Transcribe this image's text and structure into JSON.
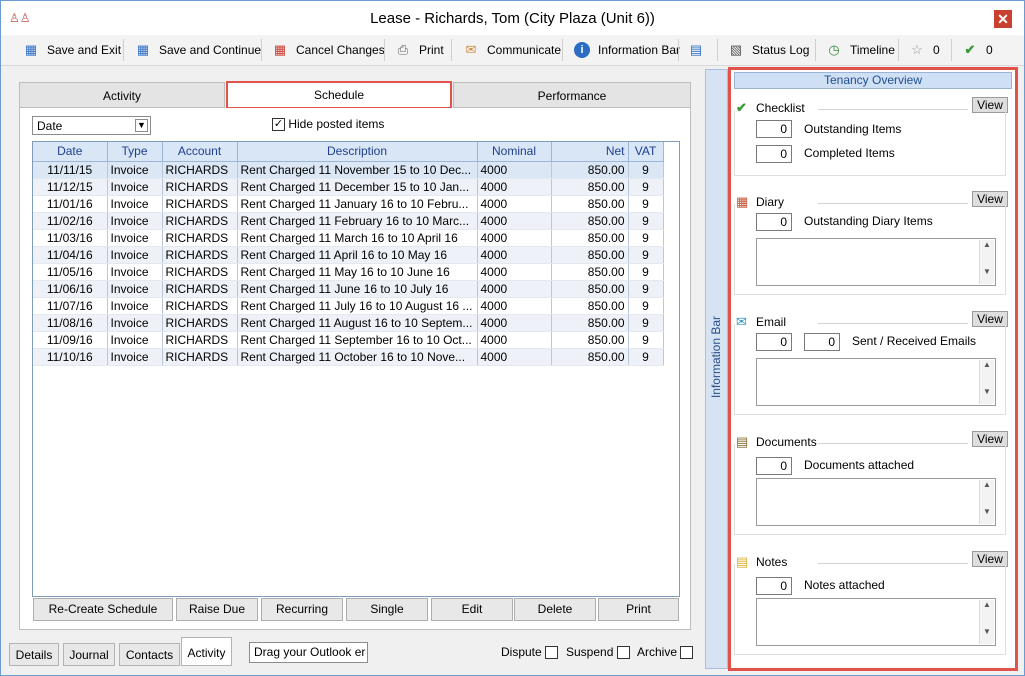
{
  "window": {
    "title": "Lease - Richards, Tom (City Plaza (Unit 6))",
    "close_icon": "close-icon"
  },
  "toolbar": {
    "save_exit": "Save and Exit",
    "save_continue": "Save and Continue",
    "cancel_changes": "Cancel Changes",
    "print": "Print",
    "communicate": "Communicate",
    "information_bar": "Information Bar",
    "status_log": "Status Log",
    "timeline": "Timeline",
    "star_count": "0",
    "check_count": "0"
  },
  "tabs": {
    "activity": "Activity",
    "schedule": "Schedule",
    "performance": "Performance"
  },
  "filter": {
    "sort_value": "Date",
    "hide_posted_label": "Hide posted items",
    "hide_posted_checked": true
  },
  "grid": {
    "columns": [
      "Date",
      "Type",
      "Account",
      "Description",
      "Nominal",
      "Net",
      "VAT"
    ],
    "rows": [
      [
        "11/11/15",
        "Invoice",
        "RICHARDS",
        "Rent Charged 11 November 15 to 10 Dec...",
        "4000",
        "850.00",
        "9"
      ],
      [
        "11/12/15",
        "Invoice",
        "RICHARDS",
        "Rent Charged 11 December 15 to 10 Jan...",
        "4000",
        "850.00",
        "9"
      ],
      [
        "11/01/16",
        "Invoice",
        "RICHARDS",
        "Rent Charged 11 January 16 to 10 Febru...",
        "4000",
        "850.00",
        "9"
      ],
      [
        "11/02/16",
        "Invoice",
        "RICHARDS",
        "Rent Charged 11 February 16 to 10 Marc...",
        "4000",
        "850.00",
        "9"
      ],
      [
        "11/03/16",
        "Invoice",
        "RICHARDS",
        "Rent Charged 11 March 16 to 10 April 16",
        "4000",
        "850.00",
        "9"
      ],
      [
        "11/04/16",
        "Invoice",
        "RICHARDS",
        "Rent Charged 11 April 16 to 10 May 16",
        "4000",
        "850.00",
        "9"
      ],
      [
        "11/05/16",
        "Invoice",
        "RICHARDS",
        "Rent Charged 11 May 16 to 10 June 16",
        "4000",
        "850.00",
        "9"
      ],
      [
        "11/06/16",
        "Invoice",
        "RICHARDS",
        "Rent Charged 11 June 16 to 10 July 16",
        "4000",
        "850.00",
        "9"
      ],
      [
        "11/07/16",
        "Invoice",
        "RICHARDS",
        "Rent Charged 11 July 16 to 10 August 16 ...",
        "4000",
        "850.00",
        "9"
      ],
      [
        "11/08/16",
        "Invoice",
        "RICHARDS",
        "Rent Charged 11 August 16 to 10 Septem...",
        "4000",
        "850.00",
        "9"
      ],
      [
        "11/09/16",
        "Invoice",
        "RICHARDS",
        "Rent Charged 11 September 16 to 10 Oct...",
        "4000",
        "850.00",
        "9"
      ],
      [
        "11/10/16",
        "Invoice",
        "RICHARDS",
        "Rent Charged 11 October 16 to 10 Nove...",
        "4000",
        "850.00",
        "9"
      ]
    ]
  },
  "actions": {
    "recreate": "Re-Create Schedule",
    "raise_due": "Raise Due",
    "recurring": "Recurring",
    "single": "Single",
    "edit": "Edit",
    "delete": "Delete",
    "print": "Print"
  },
  "bottom_tabs": {
    "details": "Details",
    "journal": "Journal",
    "contacts": "Contacts",
    "activity": "Activity"
  },
  "drag_outlook": "Drag your Outlook er",
  "flags": {
    "dispute": "Dispute",
    "suspend": "Suspend",
    "archive": "Archive"
  },
  "infobar": {
    "vertical_label": "Information Bar",
    "header": "Tenancy Overview",
    "view_label": "View",
    "checklist": {
      "title": "Checklist",
      "outstanding": "0",
      "outstanding_label": "Outstanding Items",
      "completed": "0",
      "completed_label": "Completed Items"
    },
    "diary": {
      "title": "Diary",
      "outstanding": "0",
      "outstanding_label": "Outstanding Diary Items"
    },
    "email": {
      "title": "Email",
      "sent": "0",
      "received": "0",
      "label": "Sent / Received Emails"
    },
    "documents": {
      "title": "Documents",
      "count": "0",
      "label": "Documents attached"
    },
    "notes": {
      "title": "Notes",
      "count": "0",
      "label": "Notes attached"
    }
  }
}
